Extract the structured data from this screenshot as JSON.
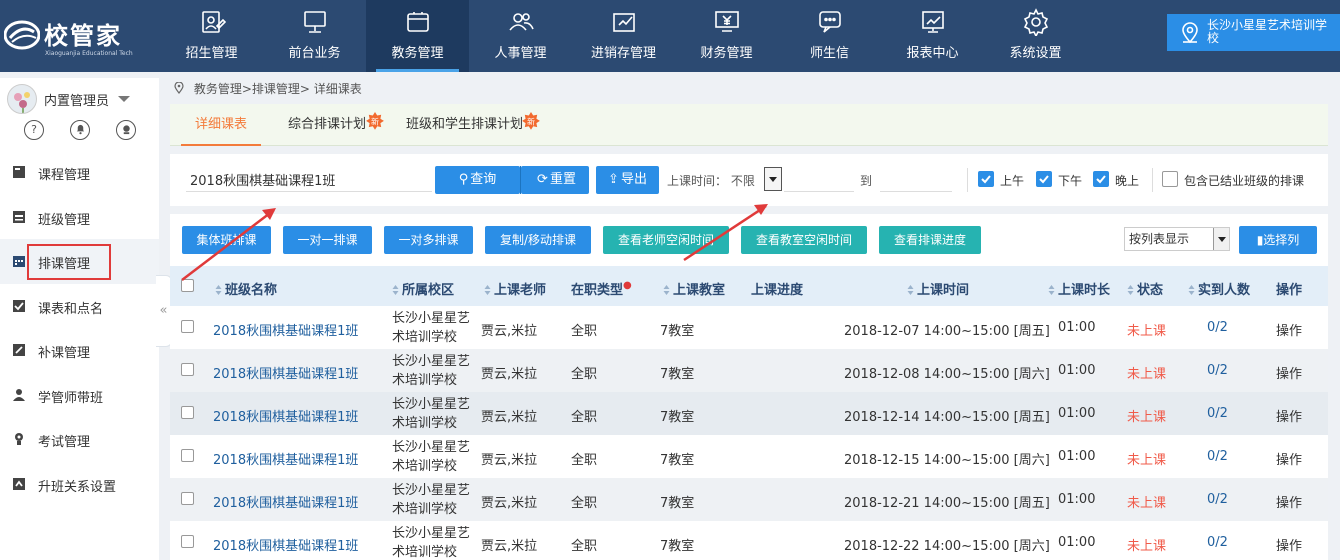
{
  "logo": {
    "name": "校管家",
    "subtitle": "Xiaoguanjia Educational Tech"
  },
  "nav": [
    {
      "label": "招生管理",
      "icon": "enrollment-icon",
      "active": false
    },
    {
      "label": "前台业务",
      "icon": "monitor-icon",
      "active": false
    },
    {
      "label": "教务管理",
      "icon": "academic-icon",
      "active": true
    },
    {
      "label": "人事管理",
      "icon": "people-icon",
      "active": false
    },
    {
      "label": "进销存管理",
      "icon": "inventory-icon",
      "active": false
    },
    {
      "label": "财务管理",
      "icon": "finance-icon",
      "active": false
    },
    {
      "label": "师生信",
      "icon": "message-icon",
      "active": false
    },
    {
      "label": "报表中心",
      "icon": "report-icon",
      "active": false
    },
    {
      "label": "系统设置",
      "icon": "gear-icon",
      "active": false
    }
  ],
  "school": {
    "name": "长沙小星星艺术培训学校"
  },
  "user": {
    "name": "内置管理员",
    "icons": [
      "?",
      "🔔",
      "☻"
    ]
  },
  "sidebar": [
    {
      "label": "课程管理",
      "icon": "course-icon"
    },
    {
      "label": "班级管理",
      "icon": "class-icon"
    },
    {
      "label": "排课管理",
      "icon": "calendar-icon",
      "active": true
    },
    {
      "label": "课表和点名",
      "icon": "checkin-icon"
    },
    {
      "label": "补课管理",
      "icon": "makeup-icon"
    },
    {
      "label": "学管师带班",
      "icon": "tutor-icon"
    },
    {
      "label": "考试管理",
      "icon": "exam-icon"
    },
    {
      "label": "升班关系设置",
      "icon": "upgrade-icon"
    }
  ],
  "collapse_glyph": "«",
  "breadcrumb": "教务管理>排课管理> 详细课表",
  "tabs": [
    {
      "label": "详细课表",
      "active": true,
      "new": false
    },
    {
      "label": "综合排课计划",
      "active": false,
      "new": true,
      "badge": "新"
    },
    {
      "label": "班级和学生排课计划",
      "active": false,
      "new": true,
      "badge": "新"
    }
  ],
  "search": {
    "value": "2018秋围棋基础课程1班",
    "query_label": "查询",
    "expand_glyph": "»",
    "reset_label": "重置",
    "export_label": "导出",
    "time_label": "上课时间：",
    "time_value": "不限",
    "to_label": "到",
    "morning": {
      "label": "上午",
      "checked": true
    },
    "afternoon": {
      "label": "下午",
      "checked": true
    },
    "evening": {
      "label": "晚上",
      "checked": true
    },
    "include_finished": {
      "label": "包含已结业班级的排课",
      "checked": false
    }
  },
  "actions": [
    {
      "label": "集体班排课",
      "style": "blue"
    },
    {
      "label": "一对一排课",
      "style": "blue"
    },
    {
      "label": "一对多排课",
      "style": "blue"
    },
    {
      "label": "复制/移动排课",
      "style": "blue"
    },
    {
      "label": "查看老师空闲时间",
      "style": "teal"
    },
    {
      "label": "查看教室空闲时间",
      "style": "teal"
    },
    {
      "label": "查看排课进度",
      "style": "teal"
    }
  ],
  "view_select": "按列表显示",
  "pick_columns": "选择列",
  "columns": {
    "class_name": "班级名称",
    "campus": "所属校区",
    "teacher": "上课老师",
    "job_type": "在职类型",
    "classroom": "上课教室",
    "progress": "上课进度",
    "time": "上课时间",
    "duration": "上课时长",
    "status": "状态",
    "attendance": "实到人数",
    "ops": "操作"
  },
  "rows": [
    {
      "class_name": "2018秋围棋基础课程1班",
      "campus": "长沙小星星艺术培训学校",
      "teacher": "贾云,米拉",
      "job_type": "全职",
      "classroom": "7教室",
      "time": "2018-12-07 14:00~15:00 [周五]",
      "duration": "01:00",
      "status": "未上课",
      "attendance": "0/2",
      "ops": "操作"
    },
    {
      "class_name": "2018秋围棋基础课程1班",
      "campus": "长沙小星星艺术培训学校",
      "teacher": "贾云,米拉",
      "job_type": "全职",
      "classroom": "7教室",
      "time": "2018-12-08 14:00~15:00 [周六]",
      "duration": "01:00",
      "status": "未上课",
      "attendance": "0/2",
      "ops": "操作"
    },
    {
      "class_name": "2018秋围棋基础课程1班",
      "campus": "长沙小星星艺术培训学校",
      "teacher": "贾云,米拉",
      "job_type": "全职",
      "classroom": "7教室",
      "time": "2018-12-14 14:00~15:00 [周五]",
      "duration": "01:00",
      "status": "未上课",
      "attendance": "0/2",
      "ops": "操作"
    },
    {
      "class_name": "2018秋围棋基础课程1班",
      "campus": "长沙小星星艺术培训学校",
      "teacher": "贾云,米拉",
      "job_type": "全职",
      "classroom": "7教室",
      "time": "2018-12-15 14:00~15:00 [周六]",
      "duration": "01:00",
      "status": "未上课",
      "attendance": "0/2",
      "ops": "操作"
    },
    {
      "class_name": "2018秋围棋基础课程1班",
      "campus": "长沙小星星艺术培训学校",
      "teacher": "贾云,米拉",
      "job_type": "全职",
      "classroom": "7教室",
      "time": "2018-12-21 14:00~15:00 [周五]",
      "duration": "01:00",
      "status": "未上课",
      "attendance": "0/2",
      "ops": "操作"
    },
    {
      "class_name": "2018秋围棋基础课程1班",
      "campus": "长沙小星星艺术培训学校",
      "teacher": "贾云,米拉",
      "job_type": "全职",
      "classroom": "7教室",
      "time": "2018-12-22 14:00~15:00 [周六]",
      "duration": "01:00",
      "status": "未上课",
      "attendance": "0/2",
      "ops": "操作"
    }
  ],
  "colors": {
    "nav_bg": "#2c4a72",
    "accent": "#2b8ee6",
    "teal": "#26b3b1",
    "tab_active": "#f37b3b",
    "status_red": "#f05b4a",
    "annotation_red": "#e03a3a"
  }
}
